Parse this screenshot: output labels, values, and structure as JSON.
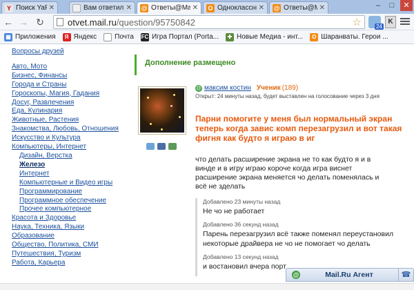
{
  "tabs": [
    {
      "title": "Поиск YaFind",
      "favicon": "Y",
      "color": "#e8e8e8",
      "fg": "#c00"
    },
    {
      "title": "Вам ответил",
      "favicon": "",
      "color": "#f0f0f0",
      "fg": "#555"
    },
    {
      "title": "Ответы@Mail",
      "favicon": "@",
      "color": "#f28b14",
      "fg": "#fff"
    },
    {
      "title": "Одноклассни",
      "favicon": "О",
      "color": "#f28b14",
      "fg": "#fff"
    },
    {
      "title": "Ответы@Mail",
      "favicon": "@",
      "color": "#f28b14",
      "fg": "#fff"
    }
  ],
  "window_controls": {
    "minimize": "–",
    "maximize": "□",
    "close": "✕"
  },
  "address": {
    "host": "otvet.mail.ru",
    "path": "/question/95750842"
  },
  "extension_badge": "24",
  "extension2_label": "K",
  "bookmarks": [
    {
      "label": "Приложения",
      "icon": "apps-icon",
      "color": "#4a86d9"
    },
    {
      "label": "Яндекс",
      "icon": "yandex-icon",
      "color": "#d22"
    },
    {
      "label": "Почта",
      "icon": "page-icon",
      "color": "#bbb"
    },
    {
      "label": "Игра Портал (Porta...",
      "icon": "fc-icon",
      "color": "#222",
      "text": "FC"
    },
    {
      "label": "Новые Медиа - инт...",
      "icon": "puzzle-icon",
      "color": "#5a8a3a"
    },
    {
      "label": "Шаранваты. Герои ...",
      "icon": "ok-icon",
      "color": "#f28b14"
    }
  ],
  "sidebar": {
    "friends": "Вопросы друзей",
    "items": [
      {
        "label": "Авто, Мото",
        "sub": false
      },
      {
        "label": "Бизнес, Финансы",
        "sub": false
      },
      {
        "label": "Города и Страны",
        "sub": false
      },
      {
        "label": "Гороскопы, Магия, Гадания",
        "sub": false
      },
      {
        "label": "Досуг, Развлечения",
        "sub": false
      },
      {
        "label": "Еда, Кулинария",
        "sub": false
      },
      {
        "label": "Животные, Растения",
        "sub": false
      },
      {
        "label": "Знакомства, Любовь, Отношения",
        "sub": false
      },
      {
        "label": "Искусство и Культура",
        "sub": false
      },
      {
        "label": "Компьютеры, Интернет",
        "sub": false
      },
      {
        "label": "Дизайн, Верстка",
        "sub": true
      },
      {
        "label": "Железо",
        "sub": true,
        "current": true
      },
      {
        "label": "Интернет",
        "sub": true
      },
      {
        "label": "Компьютерные и Видео игры",
        "sub": true
      },
      {
        "label": "Программирование",
        "sub": true
      },
      {
        "label": "Программное обеспечение",
        "sub": true
      },
      {
        "label": "Прочее компьютерное",
        "sub": true
      },
      {
        "label": "Красота и Здоровье",
        "sub": false
      },
      {
        "label": "Наука, Техника, Языки",
        "sub": false
      },
      {
        "label": "Образование",
        "sub": false
      },
      {
        "label": "Общество, Политика, СМИ",
        "sub": false
      },
      {
        "label": "Путешествия, Туризм",
        "sub": false
      },
      {
        "label": "Работа, Карьера",
        "sub": false
      }
    ]
  },
  "notice": "Дополнение размещено",
  "author": {
    "name": "максим костин",
    "rank": "Ученик",
    "points": "(189)"
  },
  "open_text": "Открыт: 24 минуты назад, будет выставлен на голосование через 3 дня",
  "question_title": "Парни помогите у меня был нормальный экран теперь когда завис комп перезагрузил и вот такая фигня как будто я играю в иг",
  "question_body": "что делать расширение экрана не то как будто я и в винде и в игру играю короче когда игра виснет расширение экрана меняется чо делать поменялась и всё не зделать",
  "additions": [
    {
      "time": "Добавлено 23 минуты назад",
      "text": "Не чо не работает"
    },
    {
      "time": "Добавлено 36 секунд назад",
      "text": "Парень перезагрузил всё также поменял переустановил некоторые драйвера не чо не помогает чо делать"
    },
    {
      "time": "Добавлено 13 секунд назад",
      "text": "и востановил вчера порт"
    }
  ],
  "agent": {
    "title": "Mail.Ru Агент"
  }
}
